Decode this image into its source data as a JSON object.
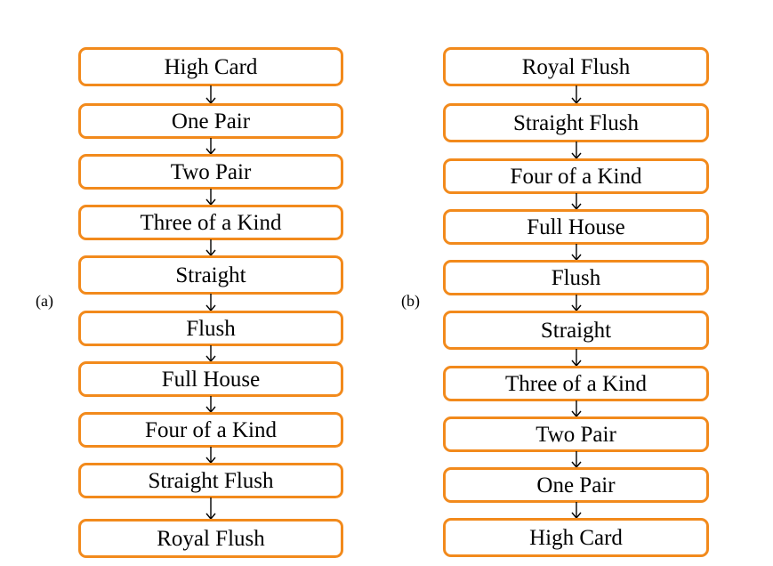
{
  "diagram": {
    "colors": {
      "box_border": "#F28A1C",
      "box_fill": "#FFFFFF",
      "text": "#000000",
      "arrow": "#000000"
    },
    "panels": [
      {
        "id": "a",
        "label": "(a)",
        "boxes": [
          "High Card",
          "One Pair",
          "Two Pair",
          "Three of a Kind",
          "Straight",
          "Flush",
          "Full House",
          "Four of a Kind",
          "Straight Flush",
          "Royal Flush"
        ]
      },
      {
        "id": "b",
        "label": "(b)",
        "boxes": [
          "Royal Flush",
          "Straight Flush",
          "Four of a Kind",
          "Full House",
          "Flush",
          "Straight",
          "Three of a Kind",
          "Two Pair",
          "One Pair",
          "High Card"
        ]
      }
    ]
  }
}
